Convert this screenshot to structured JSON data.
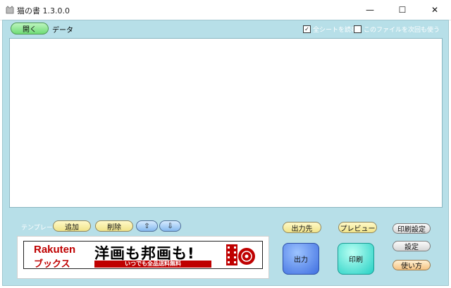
{
  "window": {
    "title": "猫の書 1.3.0.0",
    "controls": {
      "minimize": "—",
      "maximize": "☐",
      "close": "✕"
    }
  },
  "toolbar": {
    "open_label": "開く",
    "data_label": "データ",
    "read_all_sheets": {
      "label": "全シートを読む",
      "checked": true
    },
    "use_file_next_time": {
      "label": "このファイルを次回も使う",
      "checked": false
    }
  },
  "data_area": {
    "content": ""
  },
  "template": {
    "label": "テンプレート",
    "add_label": "追加",
    "delete_label": "削除",
    "up_label": "⇧",
    "down_label": "⇩"
  },
  "banner": {
    "brand": "Rakuten",
    "sub": "ブックス",
    "headline": "洋画も邦画も!",
    "strip": "いつでも全品送料無料"
  },
  "actions": {
    "output_dest_label": "出力先",
    "preview_label": "プレビュー",
    "output_label": "出力",
    "print_label": "印刷",
    "print_setting_label": "印刷設定",
    "settings_label": "設定",
    "howto_label": "使い方"
  },
  "colors": {
    "client_bg": "#b7dfe8",
    "open_button": "#6fdc76",
    "yellow_button": "#f1e48a",
    "output_button": "#3f6fe0",
    "print_button": "#25d0c4",
    "rakuten_red": "#bf0000"
  }
}
